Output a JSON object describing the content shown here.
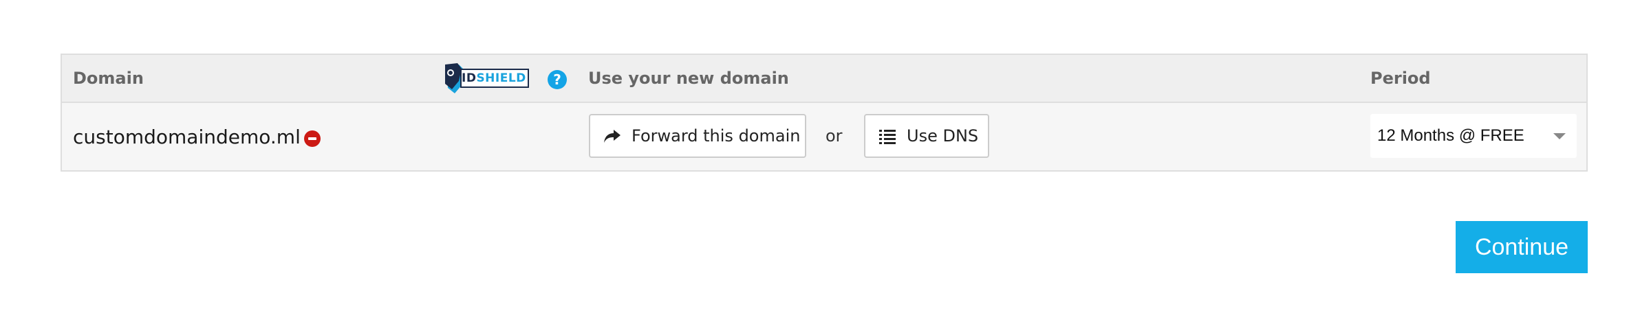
{
  "table": {
    "headers": {
      "domain": "Domain",
      "use_domain": "Use your new domain",
      "period": "Period"
    },
    "idshield": {
      "brand_id": "ID",
      "brand_shield": "SHIELD",
      "help": "?"
    },
    "row": {
      "domain_name": "customdomaindemo.ml",
      "forward_label": "Forward this domain",
      "or_text": "or",
      "dns_label": "Use DNS",
      "period_value": "12 Months @ FREE"
    }
  },
  "actions": {
    "continue_label": "Continue"
  },
  "icons": {
    "logo": "idshield-logo-icon",
    "help": "question-circle-icon",
    "remove": "minus-circle-icon",
    "forward": "share-arrow-icon",
    "dns": "list-icon",
    "caret": "chevron-down-icon"
  },
  "colors": {
    "accent": "#14aee8",
    "remove": "#cc1a14",
    "brand_dark": "#1b2b4a",
    "brand_light": "#1aa3dd"
  }
}
